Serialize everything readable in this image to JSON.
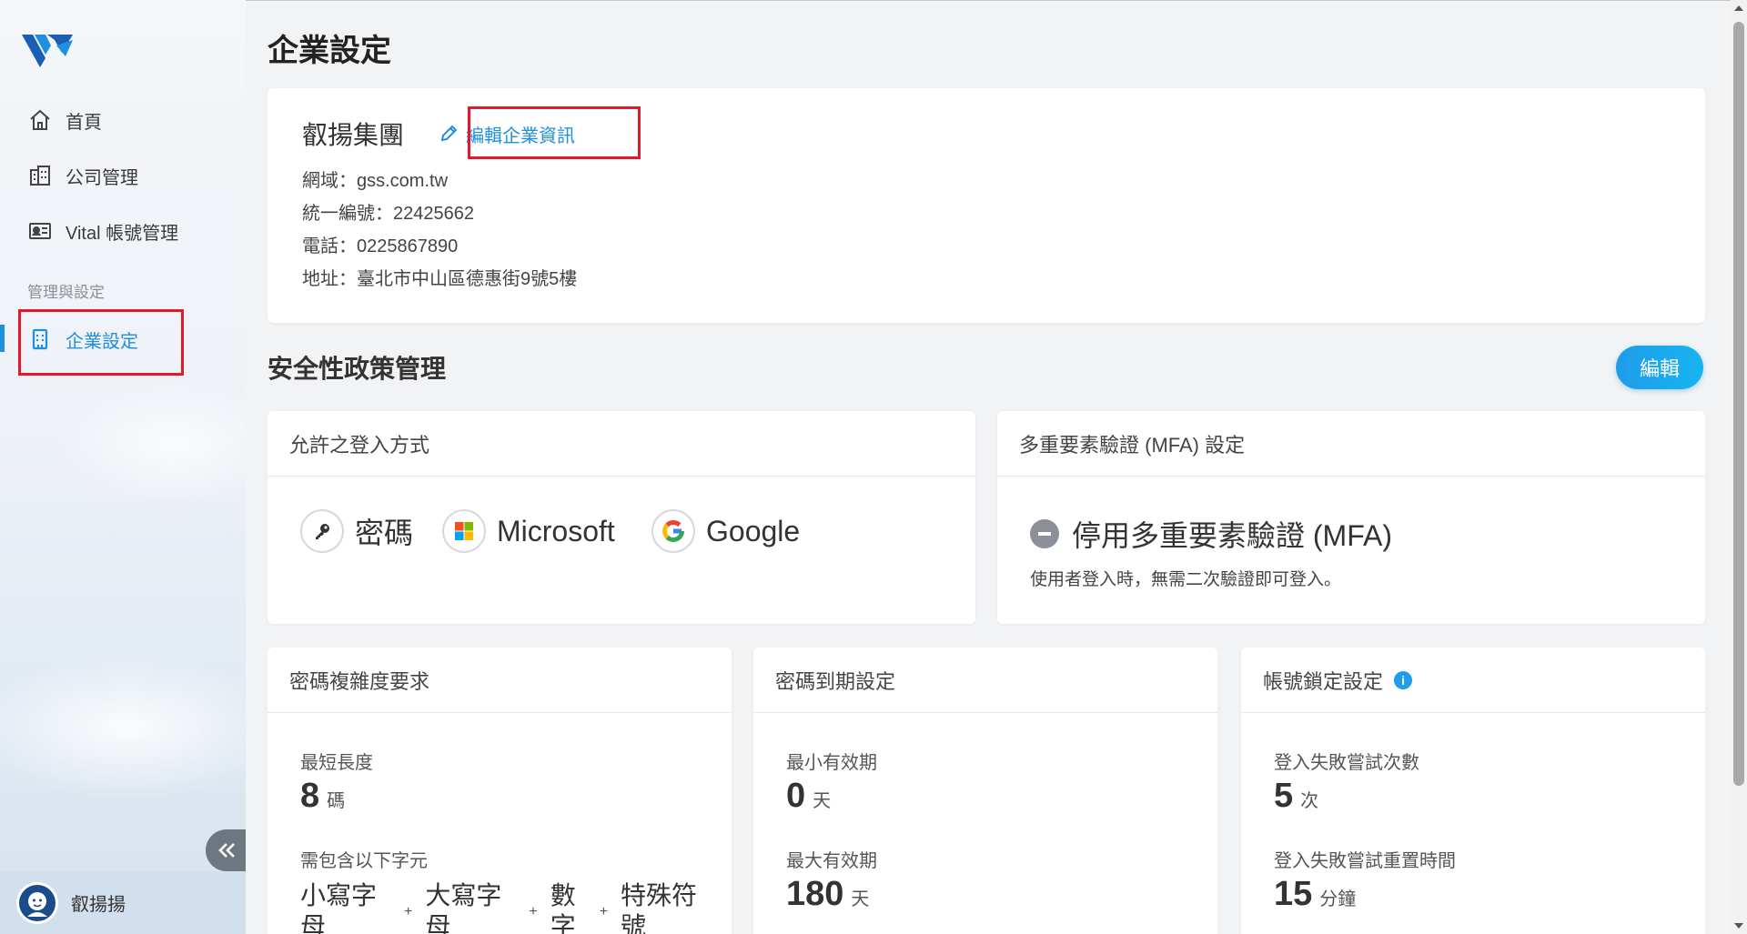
{
  "sidebar": {
    "items": [
      {
        "label": "首頁",
        "icon": "home-icon"
      },
      {
        "label": "公司管理",
        "icon": "building-icon"
      },
      {
        "label": "Vital 帳號管理",
        "icon": "id-card-icon"
      }
    ],
    "section_label": "管理與設定",
    "active_item": {
      "label": "企業設定",
      "icon": "office-icon"
    },
    "user_name": "叡揚揚"
  },
  "page": {
    "title": "企業設定"
  },
  "company": {
    "name": "叡揚集團",
    "edit_link": "編輯企業資訊",
    "domain": "網域：gss.com.tw",
    "tax_id": "統一編號：22425662",
    "phone": "電話：0225867890",
    "address": "地址：臺北市中山區德惠街9號5樓"
  },
  "security": {
    "title": "安全性政策管理",
    "edit_button": "編輯",
    "login_methods": {
      "title": "允許之登入方式",
      "methods": [
        "密碼",
        "Microsoft",
        "Google"
      ]
    },
    "mfa": {
      "title": "多重要素驗證 (MFA) 設定",
      "status": "停用多重要素驗證 (MFA)",
      "description": "使用者登入時，無需二次驗證即可登入。"
    },
    "password_complexity": {
      "title": "密碼複雜度要求",
      "min_length_label": "最短長度",
      "min_length_value": "8",
      "min_length_unit": "碼",
      "required_chars_label": "需包含以下字元",
      "required_chars": [
        "小寫字母",
        "大寫字母",
        "數字",
        "特殊符號"
      ]
    },
    "password_expiry": {
      "title": "密碼到期設定",
      "min_label": "最小有效期",
      "min_value": "0",
      "min_unit": "天",
      "max_label": "最大有效期",
      "max_value": "180",
      "max_unit": "天"
    },
    "account_lock": {
      "title": "帳號鎖定設定",
      "attempts_label": "登入失敗嘗試次數",
      "attempts_value": "5",
      "attempts_unit": "次",
      "reset_label": "登入失敗嘗試重置時間",
      "reset_value": "15",
      "reset_unit": "分鐘"
    }
  },
  "colors": {
    "accent": "#1f8fe0",
    "highlight_box": "#e0192b"
  }
}
